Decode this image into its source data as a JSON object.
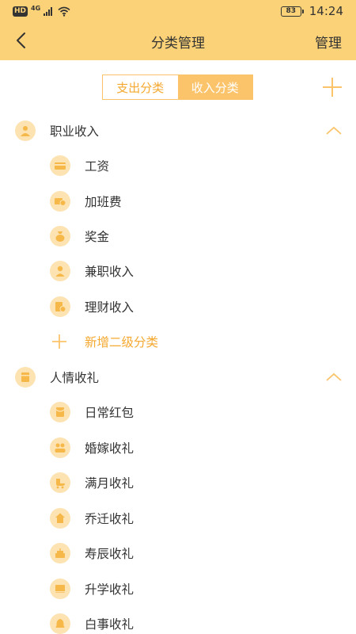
{
  "status_bar": {
    "hd": "HD",
    "network": "4G",
    "battery": "83",
    "time": "14:24"
  },
  "header": {
    "title": "分类管理",
    "manage": "管理"
  },
  "tabs": {
    "expense": "支出分类",
    "income": "收入分类",
    "active": "income"
  },
  "groups": [
    {
      "name": "职业收入",
      "icon": "people-icon",
      "expanded": true,
      "items": [
        {
          "label": "工资",
          "icon": "card-icon"
        },
        {
          "label": "加班费",
          "icon": "clock-money-icon"
        },
        {
          "label": "奖金",
          "icon": "money-bag-icon"
        },
        {
          "label": "兼职收入",
          "icon": "person-icon"
        },
        {
          "label": "理财收入",
          "icon": "finance-icon"
        }
      ],
      "add_label": "新增二级分类"
    },
    {
      "name": "人情收礼",
      "icon": "gift-icon",
      "expanded": true,
      "items": [
        {
          "label": "日常红包",
          "icon": "red-envelope-icon"
        },
        {
          "label": "婚嫁收礼",
          "icon": "couple-icon"
        },
        {
          "label": "满月收礼",
          "icon": "stroller-icon"
        },
        {
          "label": "乔迁收礼",
          "icon": "house-icon"
        },
        {
          "label": "寿辰收礼",
          "icon": "cake-icon"
        },
        {
          "label": "升学收礼",
          "icon": "book-icon"
        },
        {
          "label": "白事收礼",
          "icon": "bell-icon"
        }
      ]
    }
  ],
  "colors": {
    "header_bg": "#FBD277",
    "accent": "#F5A930",
    "icon_bg": "#FCE3B1",
    "icon_fg": "#F7B84A"
  }
}
